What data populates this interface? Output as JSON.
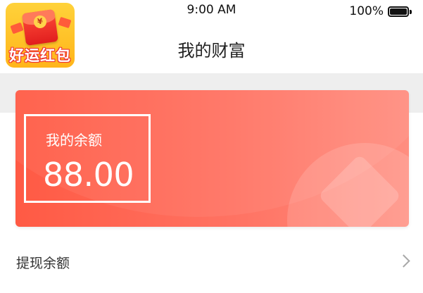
{
  "status_bar": {
    "time": "9:00 AM",
    "battery_percent": "100%",
    "battery_icon": "battery-full-icon"
  },
  "app": {
    "logo_text": "好运红包",
    "logo_icon": "red-envelope-icon"
  },
  "header": {
    "title": "我的财富"
  },
  "balance_card": {
    "label": "我的余额",
    "value": "88.00"
  },
  "menu": {
    "withdraw_label": "提现余额",
    "chevron_icon": "chevron-right-icon"
  },
  "colors": {
    "card_start": "#ff5a44",
    "card_end": "#ff8e80",
    "band": "#eeeeee"
  }
}
